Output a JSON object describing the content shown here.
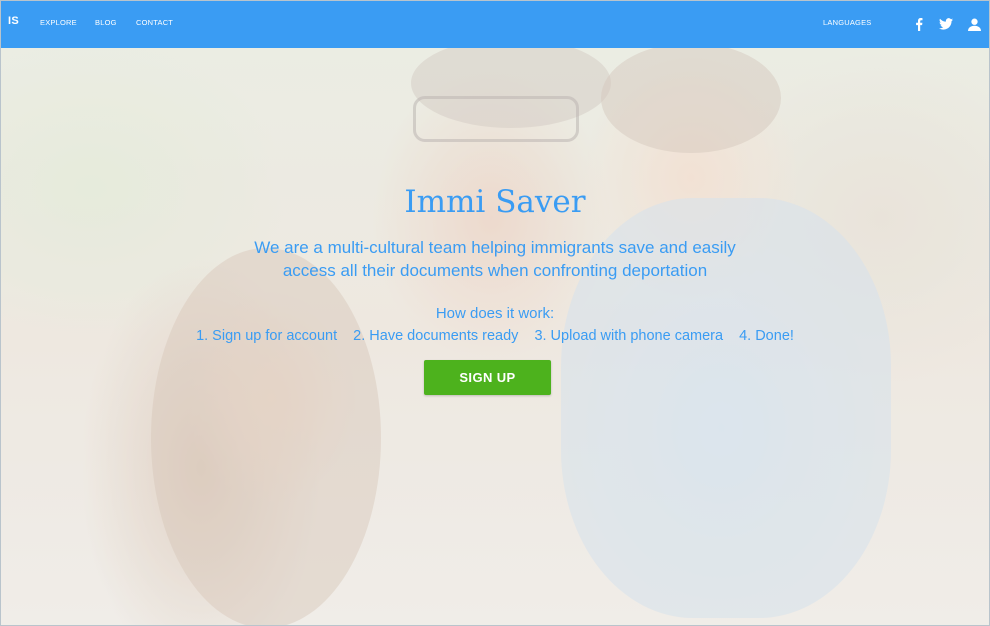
{
  "nav": {
    "brand": "IS",
    "links": {
      "explore": "EXPLORE",
      "blog": "BLOG",
      "contact": "CONTACT"
    },
    "languages": "LANGUAGES",
    "icons": [
      "facebook-icon",
      "twitter-icon",
      "user-icon"
    ],
    "background_color": "#3a9cf3"
  },
  "hero": {
    "title": "Immi Saver",
    "description_line1": "We are a multi-cultural team helping immigrants save and easily",
    "description_line2": "access all their documents when confronting deportation",
    "how_label": "How does it work:",
    "steps": [
      "1. Sign up for account",
      "2. Have documents ready",
      "3. Upload with phone camera",
      "4. Done!"
    ],
    "signup_label": "SIGN UP",
    "text_color": "#3a9cf3",
    "button_color": "#4db21d"
  }
}
